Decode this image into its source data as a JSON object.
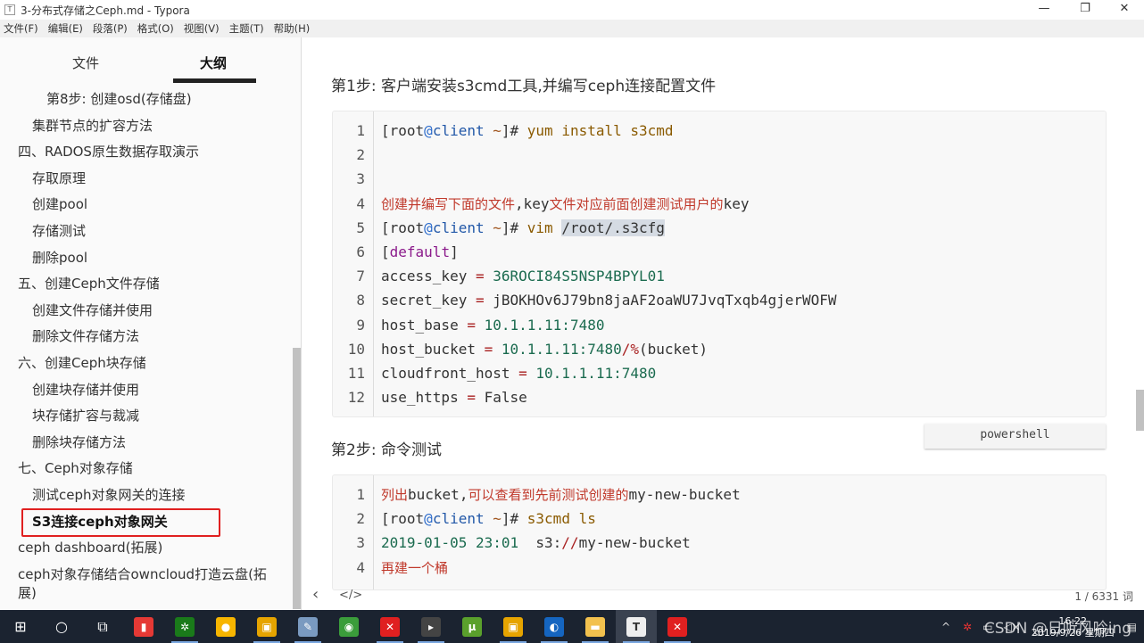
{
  "window": {
    "title": "3-分布式存储之Ceph.md - Typora",
    "app_icon": "T",
    "minimize": "—",
    "maximize": "❐",
    "close": "✕"
  },
  "menu": [
    "文件(F)",
    "编辑(E)",
    "段落(P)",
    "格式(O)",
    "视图(V)",
    "主题(T)",
    "帮助(H)"
  ],
  "sidebar": {
    "tabs": [
      {
        "label": "文件",
        "active": false
      },
      {
        "label": "大纲",
        "active": true
      }
    ],
    "items": [
      {
        "label": "第8步: 创建osd(存储盘)",
        "level": 3
      },
      {
        "label": "集群节点的扩容方法",
        "level": 2
      },
      {
        "label": "四、RADOS原生数据存取演示",
        "level": 1
      },
      {
        "label": "存取原理",
        "level": 2
      },
      {
        "label": "创建pool",
        "level": 2
      },
      {
        "label": "存储测试",
        "level": 2
      },
      {
        "label": "删除pool",
        "level": 2
      },
      {
        "label": "五、创建Ceph文件存储",
        "level": 1
      },
      {
        "label": "创建文件存储并使用",
        "level": 2
      },
      {
        "label": "删除文件存储方法",
        "level": 2
      },
      {
        "label": "六、创建Ceph块存储",
        "level": 1
      },
      {
        "label": "创建块存储并使用",
        "level": 2
      },
      {
        "label": "块存储扩容与裁减",
        "level": 2
      },
      {
        "label": "删除块存储方法",
        "level": 2
      },
      {
        "label": "七、Ceph对象存储",
        "level": 1
      },
      {
        "label": "测试ceph对象网关的连接",
        "level": 2
      },
      {
        "label": "S3连接ceph对象网关",
        "level": 2,
        "active": true
      },
      {
        "label": "ceph dashboard(拓展)",
        "level": 1
      },
      {
        "label": "ceph对象存储结合owncloud打造云盘(拓",
        "level": 1
      },
      {
        "label": "展)",
        "level": 1
      }
    ]
  },
  "main": {
    "step1_heading": "第1步: 客户端安装s3cmd工具,并编写ceph连接配置文件",
    "code1": {
      "lang": "powershell",
      "lines": [
        [
          [
            "[root",
            "def"
          ],
          [
            "@",
            "at"
          ],
          [
            "client",
            "user"
          ],
          [
            " ~",
            "tilde"
          ],
          [
            "]# ",
            "def"
          ],
          [
            "yum install s3cmd",
            "cmd"
          ]
        ],
        [],
        [],
        [
          [
            "创建并编写下面的文件",
            "cn"
          ],
          [
            ",key",
            "def"
          ],
          [
            "文件对应前面创建测试用户的",
            "cn"
          ],
          [
            "key",
            "def"
          ]
        ],
        [
          [
            "[root",
            "def"
          ],
          [
            "@",
            "at"
          ],
          [
            "client",
            "user"
          ],
          [
            " ~",
            "tilde"
          ],
          [
            "]# ",
            "def"
          ],
          [
            "vim ",
            "cmd"
          ],
          [
            "/root/.s3cfg",
            "sel"
          ]
        ],
        [
          [
            "[",
            "def"
          ],
          [
            "default",
            "kw"
          ],
          [
            "]",
            "def"
          ]
        ],
        [
          [
            "access_key ",
            "def"
          ],
          [
            "=",
            "op"
          ],
          [
            " ",
            "def"
          ],
          [
            "36ROCI84S5NSP4BPYL01",
            "num"
          ]
        ],
        [
          [
            "secret_key ",
            "def"
          ],
          [
            "=",
            "op"
          ],
          [
            " jBOKHOv6J79bn8jaAF2oaWU7JvqTxqb4gjerWOFW",
            "def"
          ]
        ],
        [
          [
            "host_base ",
            "def"
          ],
          [
            "=",
            "op"
          ],
          [
            " ",
            "def"
          ],
          [
            "10.1.1.11:7480",
            "num"
          ]
        ],
        [
          [
            "host_bucket ",
            "def"
          ],
          [
            "=",
            "op"
          ],
          [
            " ",
            "def"
          ],
          [
            "10.1.1.11:7480",
            "num"
          ],
          [
            "/%",
            "op"
          ],
          [
            "(bucket)",
            "def"
          ]
        ],
        [
          [
            "cloudfront_host ",
            "def"
          ],
          [
            "=",
            "op"
          ],
          [
            " ",
            "def"
          ],
          [
            "10.1.1.11:7480",
            "num"
          ]
        ],
        [
          [
            "use_https ",
            "def"
          ],
          [
            "=",
            "op"
          ],
          [
            " False",
            "def"
          ]
        ]
      ]
    },
    "step2_heading": "第2步: 命令测试",
    "code2": {
      "lines": [
        [
          [
            "列出",
            "cn"
          ],
          [
            "bucket,",
            "def"
          ],
          [
            "可以查看到先前测试创建的",
            "cn"
          ],
          [
            "my-new-bucket",
            "def"
          ]
        ],
        [
          [
            "[root",
            "def"
          ],
          [
            "@",
            "at"
          ],
          [
            "client",
            "user"
          ],
          [
            " ~",
            "tilde"
          ],
          [
            "]# ",
            "def"
          ],
          [
            "s3cmd ls",
            "cmd"
          ]
        ],
        [
          [
            "2019-01-05 23:01",
            "num"
          ],
          [
            "  s3:",
            "def"
          ],
          [
            "//",
            "op"
          ],
          [
            "my-new-bucket",
            "def"
          ]
        ],
        [
          [
            "再建一个桶",
            "cn"
          ]
        ]
      ]
    },
    "status": {
      "back": "‹",
      "source": "</>",
      "word_count": "1 / 6331 词"
    }
  },
  "taskbar": {
    "apps": [
      {
        "icon": "windows-start-icon",
        "glyph": "⊞"
      },
      {
        "icon": "search-cortana-icon",
        "glyph": "○"
      },
      {
        "icon": "task-view-icon",
        "glyph": "⧉"
      },
      {
        "icon": "app-colorful-icon",
        "color": "#e53935",
        "glyph": "▮"
      },
      {
        "icon": "app-green-icon",
        "color": "#1a7a1a",
        "glyph": "✲"
      },
      {
        "icon": "app-qq-icon",
        "color": "#f7b500",
        "glyph": "●"
      },
      {
        "icon": "app-vm-icon",
        "color": "#e6a400",
        "glyph": "▣"
      },
      {
        "icon": "app-paint-icon",
        "color": "#7a9ac0",
        "glyph": "✎"
      },
      {
        "icon": "chrome-icon",
        "color": "#3b9d3b",
        "glyph": "◉"
      },
      {
        "icon": "xmind-icon",
        "color": "#e02020",
        "glyph": "✕"
      },
      {
        "icon": "terminal-icon",
        "color": "#444",
        "glyph": "▸"
      },
      {
        "icon": "utorrent-icon",
        "color": "#5aa02c",
        "glyph": "µ"
      },
      {
        "icon": "app-vm2-icon",
        "color": "#e6a400",
        "glyph": "▣"
      },
      {
        "icon": "app-blue-icon",
        "color": "#1565c0",
        "glyph": "◐"
      },
      {
        "icon": "file-explorer-icon",
        "color": "#f2c14e",
        "glyph": "▬"
      },
      {
        "icon": "typora-icon",
        "color": "#eee",
        "glyph": "T"
      },
      {
        "icon": "xmind2-icon",
        "color": "#e02020",
        "glyph": "✕"
      }
    ],
    "tray": {
      "chevron": "^",
      "clock_time": "16:22",
      "clock_date": "2019/9/26 星期四",
      "watermark": "CSDN @日听风吟ing"
    }
  }
}
